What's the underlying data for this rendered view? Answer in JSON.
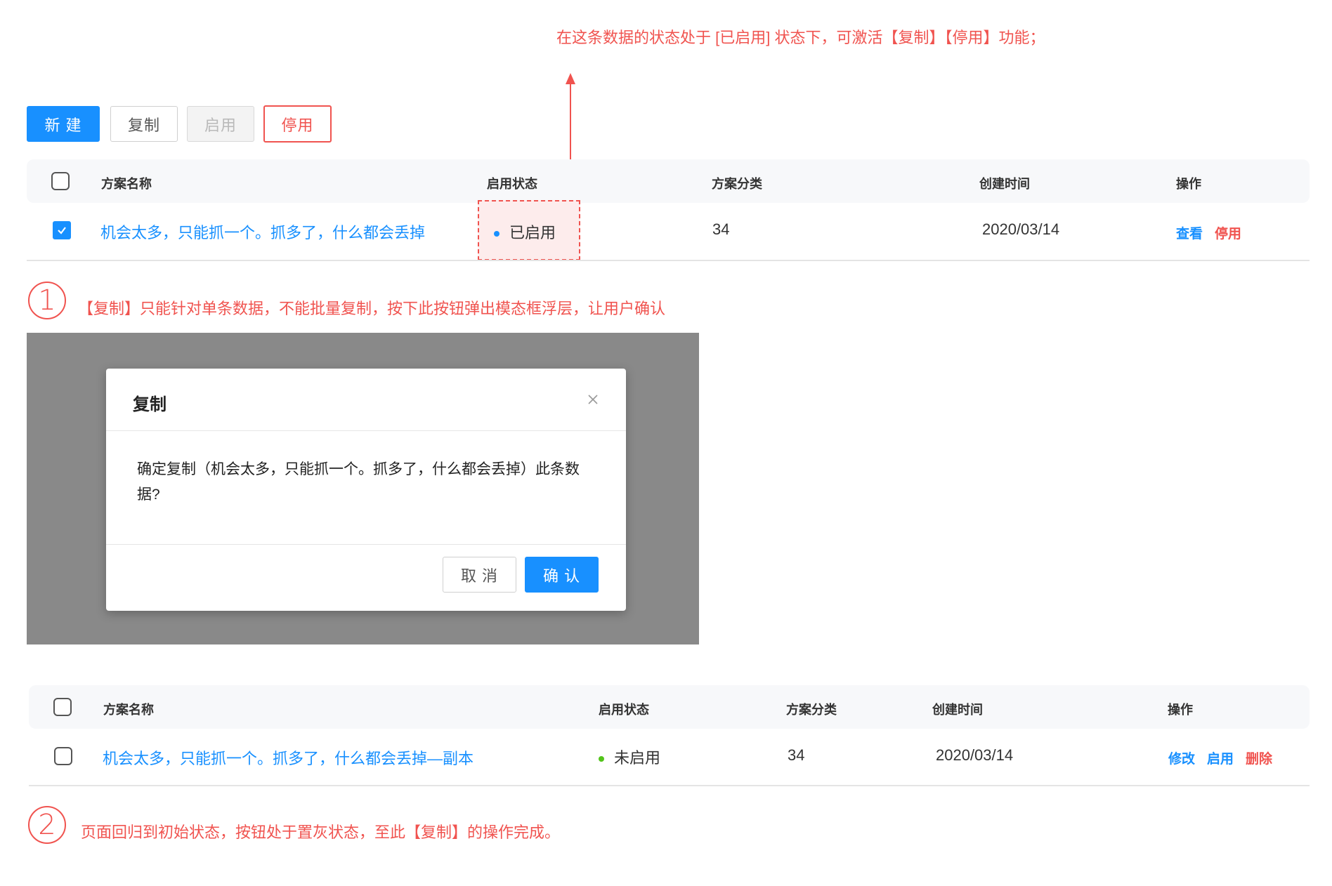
{
  "annotations": {
    "top_note": "在这条数据的状态处于 [已启用] 状态下，可激活【复制】【停用】功能；",
    "step1_num": "1",
    "step1_note": "【复制】只能针对单条数据，不能批量复制，按下此按钮弹出模态框浮层，让用户确认",
    "step2_num": "2",
    "step2_note": "页面回归到初始状态，按钮处于置灰状态，至此【复制】的操作完成。"
  },
  "toolbar": {
    "new_label": "新 建",
    "copy_label": "复制",
    "enable_label": "启用",
    "disable_label": "停用"
  },
  "table1": {
    "headers": {
      "name": "方案名称",
      "status": "启用状态",
      "category": "方案分类",
      "created": "创建时间",
      "actions": "操作"
    },
    "row": {
      "checked": true,
      "name": "机会太多，只能抓一个。抓多了，什么都会丢掉",
      "status": "已启用",
      "category": "34",
      "created": "2020/03/14",
      "action_view": "查看",
      "action_disable": "停用"
    }
  },
  "modal": {
    "title": "复制",
    "close_icon": "close-icon",
    "body": "确定复制（机会太多，只能抓一个。抓多了，什么都会丢掉）此条数据?",
    "cancel_label": "取 消",
    "confirm_label": "确 认"
  },
  "table2": {
    "headers": {
      "name": "方案名称",
      "status": "启用状态",
      "category": "方案分类",
      "created": "创建时间",
      "actions": "操作"
    },
    "row": {
      "checked": false,
      "name": "机会太多，只能抓一个。抓多了，什么都会丢掉—副本",
      "status": "未启用",
      "category": "34",
      "created": "2020/03/14",
      "action_edit": "修改",
      "action_enable": "启用",
      "action_delete": "删除"
    }
  },
  "colors": {
    "primary": "#1890ff",
    "danger": "#f0534f",
    "enabled_dot": "#1890ff",
    "disabled_dot": "#52c41a",
    "overlay": "#898989"
  }
}
